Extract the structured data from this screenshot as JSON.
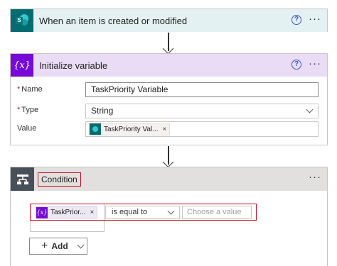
{
  "trigger": {
    "title": "When an item is created or modified",
    "help_glyph": "?",
    "more_glyph": "···",
    "icon": "sharepoint-icon"
  },
  "init_variable": {
    "title": "Initialize variable",
    "help_glyph": "?",
    "more_glyph": "···",
    "icon": "variable-icon",
    "icon_glyph": "{x}",
    "fields": {
      "name_label": "Name",
      "name_value": "TaskPriority Variable",
      "type_label": "Type",
      "type_value": "String",
      "value_label": "Value",
      "value_token": "TaskPriority Val...",
      "required_marker": "*"
    }
  },
  "condition": {
    "title": "Condition",
    "more_glyph": "···",
    "icon": "condition-icon",
    "row": {
      "left_token": "TaskPrior...",
      "operator": "is equal to",
      "right_placeholder": "Choose a value"
    },
    "add_label": "Add",
    "remove_glyph": "×"
  },
  "colors": {
    "sharepoint": "#036c70",
    "variable": "#770bd6",
    "condition": "#484f58",
    "highlight": "#c50f1f",
    "help": "#3a55c8"
  }
}
